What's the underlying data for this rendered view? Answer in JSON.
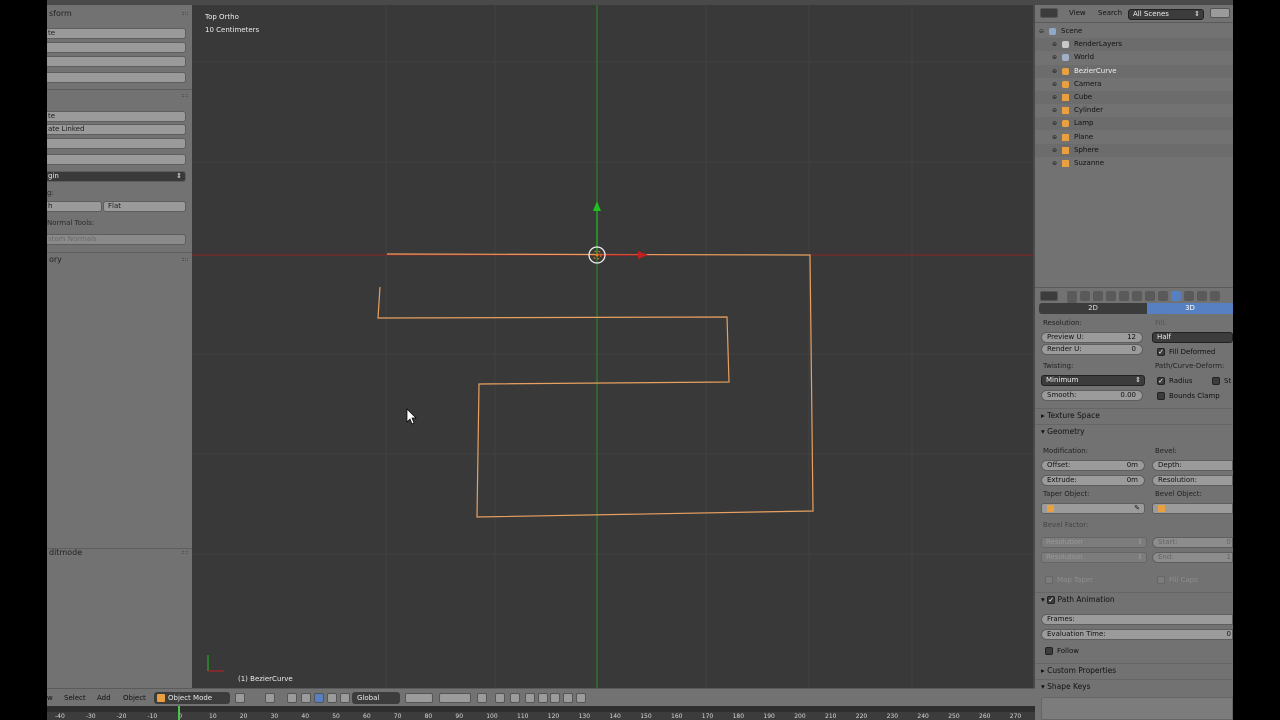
{
  "toolshelf": {
    "transform_title": "sform",
    "buttons_a": [
      "te",
      "",
      "",
      ""
    ],
    "buttons_b": [
      "te",
      "ate Linked",
      "",
      ""
    ],
    "origin_drop": "gin",
    "shading_label": "g:",
    "shading_left": "h",
    "shading_flat": "Flat",
    "normal_tools": "Normal Tools:",
    "custom_normals": "stom Normals",
    "history_title": "ory",
    "editmode_title": "ditmode"
  },
  "viewport": {
    "view_name": "Top Ortho",
    "scale": "10 Centimeters",
    "object_label": "(1) BezierCurve"
  },
  "vpheader": {
    "view": "w",
    "select": "Select",
    "add": "Add",
    "object": "Object",
    "mode": "Object Mode",
    "orientation": "Global"
  },
  "timeline": {
    "frames": [
      "-40",
      "-30",
      "-20",
      "-10",
      "0",
      "10",
      "20",
      "30",
      "40",
      "50",
      "60",
      "70",
      "80",
      "90",
      "100",
      "110",
      "120",
      "130",
      "140",
      "150",
      "160",
      "170",
      "180",
      "190",
      "200",
      "210",
      "220",
      "230",
      "240",
      "250",
      "260",
      "270",
      "280"
    ]
  },
  "outliner": {
    "view": "View",
    "search": "Search",
    "scope": "All Scenes",
    "items": [
      {
        "label": "Scene",
        "indent": 0,
        "icon": "scene-icon"
      },
      {
        "label": "RenderLayers",
        "indent": 1,
        "icon": "renderlayers-icon"
      },
      {
        "label": "World",
        "indent": 1,
        "icon": "world-icon"
      },
      {
        "label": "BezierCurve",
        "indent": 1,
        "icon": "curve-icon",
        "selected": true
      },
      {
        "label": "Camera",
        "indent": 1,
        "icon": "camera-icon"
      },
      {
        "label": "Cube",
        "indent": 1,
        "icon": "mesh-icon"
      },
      {
        "label": "Cylinder",
        "indent": 1,
        "icon": "mesh-icon"
      },
      {
        "label": "Lamp",
        "indent": 1,
        "icon": "lamp-icon"
      },
      {
        "label": "Plane",
        "indent": 1,
        "icon": "mesh-icon"
      },
      {
        "label": "Sphere",
        "indent": 1,
        "icon": "mesh-icon"
      },
      {
        "label": "Suzanne",
        "indent": 1,
        "icon": "mesh-icon"
      }
    ]
  },
  "properties": {
    "tab_2d": "2D",
    "tab_3d": "3D",
    "resolution": "Resolution:",
    "preview_u": "Preview U:",
    "preview_u_val": "12",
    "render_u": "Render U:",
    "render_u_val": "0",
    "fill": "Fill:",
    "fill_val": "Half",
    "fill_deformed": "Fill Deformed",
    "twisting": "Twisting:",
    "twisting_val": "Minimum",
    "path_deform": "Path/Curve-Deform:",
    "radius": "Radius",
    "stretch": "St",
    "smooth": "Smooth:",
    "smooth_val": "0.00",
    "bounds_clamp": "Bounds Clamp",
    "texture_space": "Texture Space",
    "geometry": "Geometry",
    "modification": "Modification:",
    "bevel": "Bevel:",
    "offset": "Offset:",
    "offset_val": "0m",
    "depth": "Depth:",
    "extrude": "Extrude:",
    "extrude_val": "0m",
    "resolution2": "Resolution:",
    "taper_object": "Taper Object:",
    "bevel_object": "Bevel Object:",
    "bevel_factor": "Bevel Factor:",
    "res_drop1": "Resolution",
    "res_drop2": "Resolution",
    "start": "Start:",
    "start_val": "0",
    "end": "End:",
    "end_val": "1",
    "map_taper": "Map Taper",
    "fill_caps": "Fill Caps",
    "path_animation": "Path Animation",
    "frames": "Frames:",
    "eval_time": "Evaluation Time:",
    "eval_time_val": "0",
    "follow": "Follow",
    "custom_properties": "Custom Properties",
    "shape_keys": "Shape Keys"
  },
  "colors": {
    "curve": "#e8a060",
    "x_axis": "#a02020",
    "y_axis": "#20a020",
    "viewport_bg": "#393939",
    "panel_bg": "#727272",
    "accent": "#5680c2"
  }
}
